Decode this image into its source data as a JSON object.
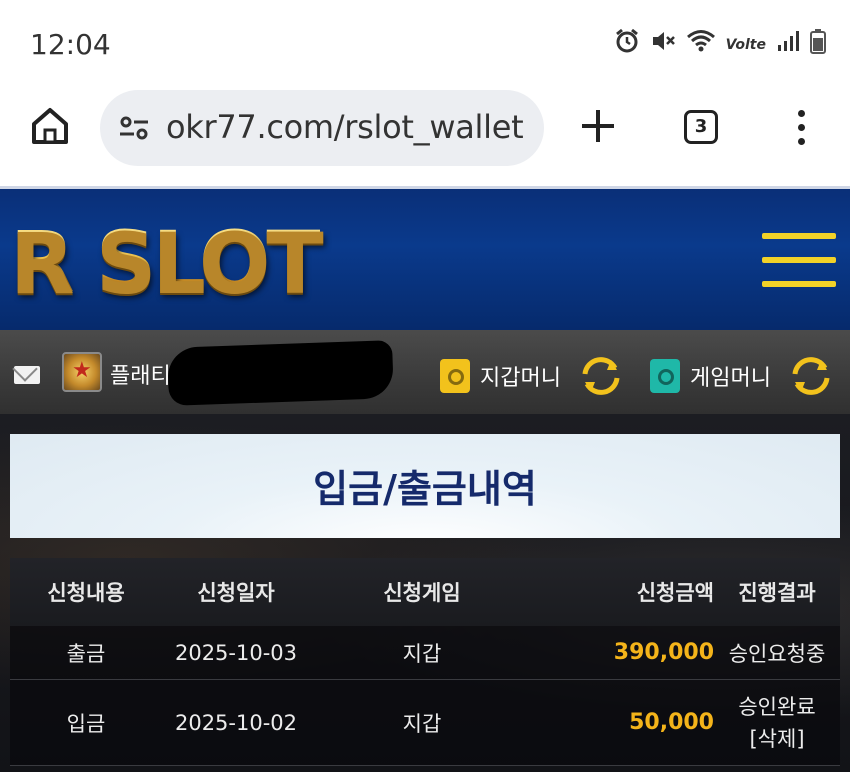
{
  "status_bar": {
    "time": "12:04",
    "icons": [
      "alarm-icon",
      "mute-icon",
      "wifi-icon",
      "volte-icon",
      "signal-icon",
      "battery-icon"
    ],
    "volte_label": "Volte"
  },
  "browser": {
    "url": "okr77.com/rslot_wallet",
    "tab_count": "3"
  },
  "site": {
    "logo_text": "R SLOT",
    "user_name_visible": "플래티",
    "wallet_label": "지갑머니",
    "game_label": "게임머니"
  },
  "page": {
    "title": "입금/출금내역"
  },
  "table": {
    "headers": [
      "신청내용",
      "신청일자",
      "신청게임",
      "신청금액",
      "진행결과"
    ],
    "rows": [
      {
        "type": "출금",
        "date": "2025-10-03",
        "game": "지갑",
        "amount": "390,000",
        "result": "승인요청중",
        "action": ""
      },
      {
        "type": "입금",
        "date": "2025-10-02",
        "game": "지갑",
        "amount": "50,000",
        "result": "승인완료",
        "action": "[삭제]"
      }
    ]
  },
  "colors": {
    "header_blue": "#0a3a8c",
    "hamburger_yellow": "#f2d228",
    "wallet_icon": "#f2c21c",
    "game_icon": "#1fb8a8",
    "amount_gold": "#f4b41a",
    "title_navy": "#152a6b"
  }
}
